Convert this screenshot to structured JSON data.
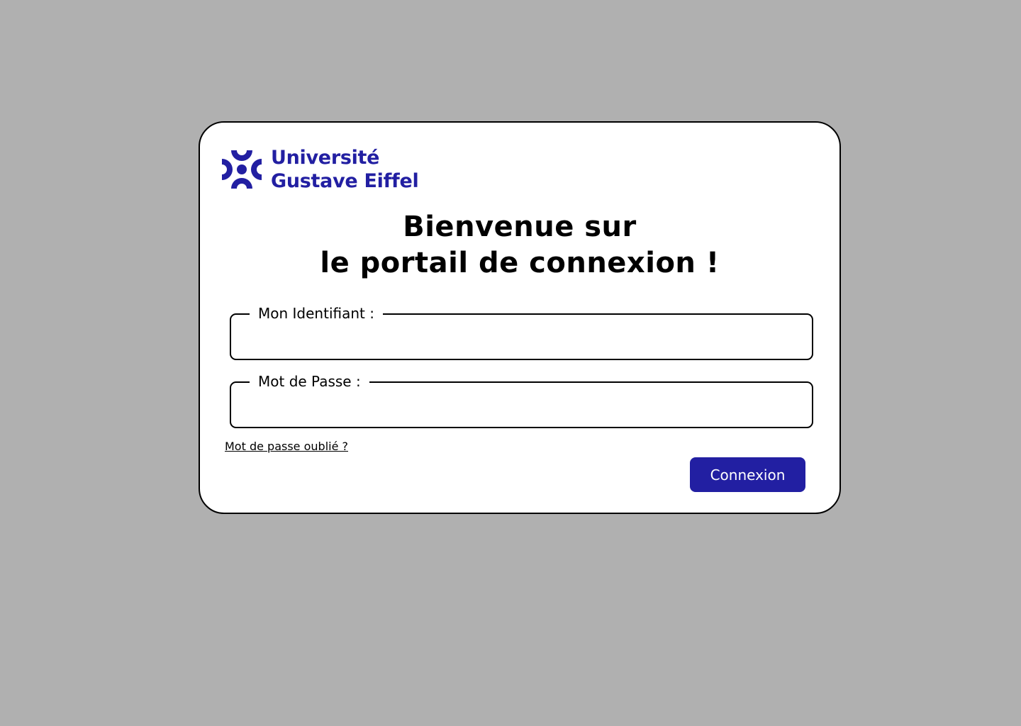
{
  "logo": {
    "line1": "Université",
    "line2": "Gustave Eiffel",
    "icon": "university-logo-icon",
    "color": "#221fa2"
  },
  "heading": {
    "line1": "Bienvenue sur",
    "line2": "le portail de connexion !"
  },
  "form": {
    "username_label": "Mon Identifiant :",
    "username_value": "",
    "password_label": "Mot de Passe :",
    "password_value": "",
    "forgot_link": "Mot de passe oublié ?",
    "submit_label": "Connexion"
  },
  "colors": {
    "background": "#b0b0b0",
    "card": "#ffffff",
    "accent": "#221fa2"
  }
}
